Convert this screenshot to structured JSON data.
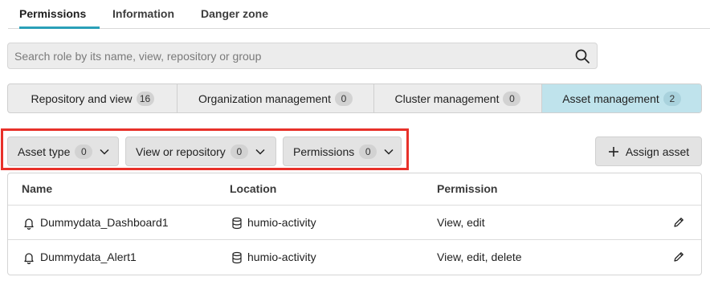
{
  "tabs": [
    {
      "label": "Permissions",
      "active": true
    },
    {
      "label": "Information",
      "active": false
    },
    {
      "label": "Danger zone",
      "active": false
    }
  ],
  "search": {
    "placeholder": "Search role by its name, view, repository or group",
    "value": "",
    "icon": "search-icon"
  },
  "categories": [
    {
      "label": "Repository and view",
      "count": "16",
      "active": false
    },
    {
      "label": "Organization management",
      "count": "0",
      "active": false
    },
    {
      "label": "Cluster management",
      "count": "0",
      "active": false
    },
    {
      "label": "Asset management",
      "count": "2",
      "active": true
    }
  ],
  "filters": [
    {
      "label": "Asset type",
      "count": "0",
      "icon": "chevron-down-icon"
    },
    {
      "label": "View or repository",
      "count": "0",
      "icon": "chevron-down-icon"
    },
    {
      "label": "Permissions",
      "count": "0",
      "icon": "chevron-down-icon"
    }
  ],
  "assign_button": {
    "label": "Assign asset",
    "icon": "plus-icon"
  },
  "table": {
    "columns": [
      "Name",
      "Location",
      "Permission"
    ],
    "rows": [
      {
        "name": "Dummydata_Dashboard1",
        "name_icon": "bell-icon",
        "location": "humio-activity",
        "location_icon": "database-icon",
        "permission": "View, edit",
        "action_icon": "pencil-icon"
      },
      {
        "name": "Dummydata_Alert1",
        "name_icon": "bell-icon",
        "location": "humio-activity",
        "location_icon": "database-icon",
        "permission": "View, edit, delete",
        "action_icon": "pencil-icon"
      }
    ]
  },
  "colors": {
    "accent": "#2aa0b8",
    "active_segment": "#bfe3ec",
    "highlight": "#e8312a"
  }
}
